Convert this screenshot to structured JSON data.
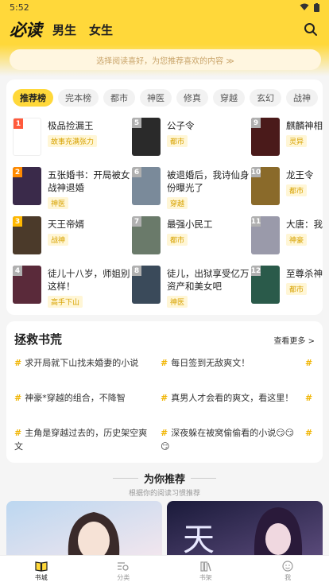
{
  "status": {
    "time": "5:52"
  },
  "header": {
    "logo": "必读",
    "tabs": [
      "男生",
      "女生"
    ]
  },
  "tip": "选择阅读喜好，为您推荐喜欢的内容 ≫",
  "ranking": {
    "chips": [
      "推荐榜",
      "完本榜",
      "都市",
      "神医",
      "修真",
      "穿越",
      "玄幻",
      "战神"
    ],
    "books": [
      {
        "rank": "1",
        "title": "极品捡漏王",
        "tag": "故事充满张力",
        "rank_color": "#ff5a3c",
        "cover": "#ffffff"
      },
      {
        "rank": "2",
        "title": "五张婚书：开局被女战神退婚",
        "tag": "神医",
        "rank_color": "#ff8a00",
        "cover": "#3a2a4a"
      },
      {
        "rank": "3",
        "title": "天王帝婿",
        "tag": "战神",
        "rank_color": "#ffb800",
        "cover": "#4b3a2a"
      },
      {
        "rank": "4",
        "title": "徒儿十八岁，师姐别这样！",
        "tag": "高手下山",
        "rank_color": "#b0b0b0",
        "cover": "#5a2a3a"
      },
      {
        "rank": "5",
        "title": "公子令",
        "tag": "都市",
        "rank_color": "#b0b0b0",
        "cover": "#2a2a2a"
      },
      {
        "rank": "6",
        "title": "被退婚后，我诗仙身份曝光了",
        "tag": "穿越",
        "rank_color": "#b0b0b0",
        "cover": "#7a8a9a"
      },
      {
        "rank": "7",
        "title": "最强小民工",
        "tag": "都市",
        "rank_color": "#b0b0b0",
        "cover": "#6a7a6a"
      },
      {
        "rank": "8",
        "title": "徒儿，出狱享受亿万资产和美女吧",
        "tag": "神医",
        "rank_color": "#b0b0b0",
        "cover": "#3a4a5a"
      },
      {
        "rank": "9",
        "title": "麒麟神相",
        "tag": "灵异",
        "rank_color": "#b0b0b0",
        "cover": "#4a1a1a"
      },
      {
        "rank": "10",
        "title": "龙王令",
        "tag": "都市",
        "rank_color": "#b0b0b0",
        "cover": "#8a6a2a"
      },
      {
        "rank": "11",
        "title": "大唐：我兄道弟",
        "tag": "神豪",
        "rank_color": "#b0b0b0",
        "cover": "#9a9aaa"
      },
      {
        "rank": "12",
        "title": "至尊杀神",
        "tag": "都市",
        "rank_color": "#b0b0b0",
        "cover": "#2a5a4a"
      }
    ]
  },
  "rescue": {
    "title": "拯救书荒",
    "see_more": "查看更多 >",
    "topics": [
      [
        "求开局就下山找未婚妻的小说",
        "每日签到无敌爽文！"
      ],
      [
        "神豪*穿越的组合，不降智",
        "真男人才会看的爽文，看这里！"
      ],
      [
        "主角是穿越过去的，历史架空爽文",
        "深夜躲在被窝偷偷看的小说😏😏😏"
      ]
    ]
  },
  "recommend": {
    "title": "为你推荐",
    "subtitle": "根据你的阅读习惯推荐"
  },
  "nav": [
    "书城",
    "分类",
    "书架",
    "我"
  ],
  "colors": {
    "accent": "#ffd83a"
  }
}
